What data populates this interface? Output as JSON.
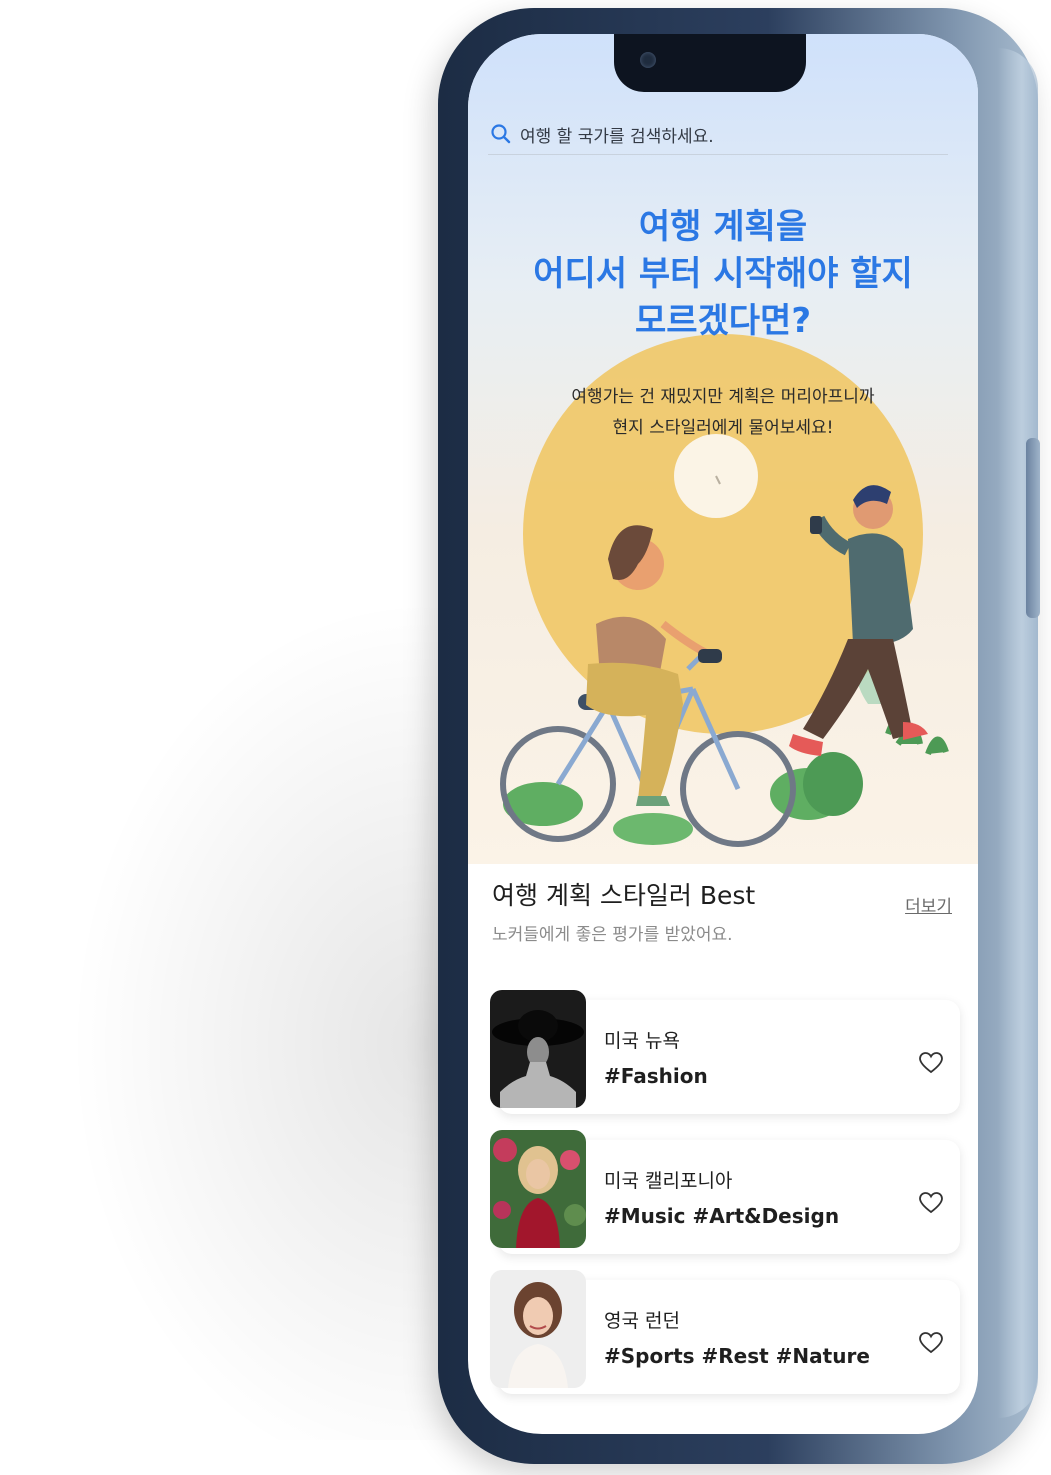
{
  "search": {
    "placeholder": "여행 할 국가를 검색하세요."
  },
  "hero": {
    "headline_lines": [
      "여행 계획을",
      "어디서 부터 시작해야 할지",
      "모르겠다면?"
    ],
    "sub_lines": [
      "여행가는 건 재밌지만 계획은 머리아프니까",
      "현지 스타일러에게 물어보세요!"
    ]
  },
  "section": {
    "title": "여행 계획 스타일러 Best",
    "subtitle": "노커들에게 좋은 평가를 받았어요.",
    "more_label": "더보기"
  },
  "stylers": [
    {
      "location": "미국 뉴욕",
      "tags": "#Fashion"
    },
    {
      "location": "미국 캘리포니아",
      "tags": "#Music #Art&Design"
    },
    {
      "location": "영국 런던",
      "tags": "#Sports #Rest #Nature"
    }
  ],
  "colors": {
    "accent_blue": "#2b78e4",
    "phone_body": "#2c3f5e",
    "sun": "#f0c45e"
  },
  "icons": {
    "search": "search-icon",
    "heart": "heart-icon"
  }
}
